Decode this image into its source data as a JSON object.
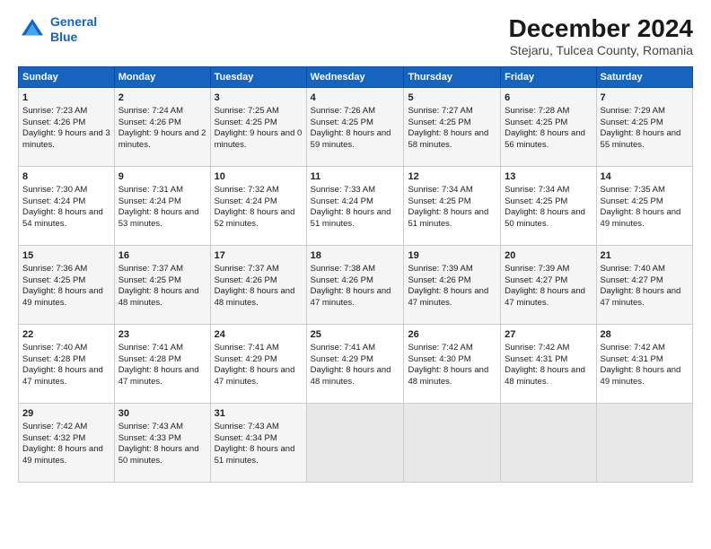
{
  "logo": {
    "line1": "General",
    "line2": "Blue"
  },
  "title": "December 2024",
  "subtitle": "Stejaru, Tulcea County, Romania",
  "header_days": [
    "Sunday",
    "Monday",
    "Tuesday",
    "Wednesday",
    "Thursday",
    "Friday",
    "Saturday"
  ],
  "weeks": [
    [
      {
        "day": "1",
        "sunrise": "7:23 AM",
        "sunset": "4:26 PM",
        "daylight": "9 hours and 3 minutes."
      },
      {
        "day": "2",
        "sunrise": "7:24 AM",
        "sunset": "4:26 PM",
        "daylight": "9 hours and 2 minutes."
      },
      {
        "day": "3",
        "sunrise": "7:25 AM",
        "sunset": "4:25 PM",
        "daylight": "9 hours and 0 minutes."
      },
      {
        "day": "4",
        "sunrise": "7:26 AM",
        "sunset": "4:25 PM",
        "daylight": "8 hours and 59 minutes."
      },
      {
        "day": "5",
        "sunrise": "7:27 AM",
        "sunset": "4:25 PM",
        "daylight": "8 hours and 58 minutes."
      },
      {
        "day": "6",
        "sunrise": "7:28 AM",
        "sunset": "4:25 PM",
        "daylight": "8 hours and 56 minutes."
      },
      {
        "day": "7",
        "sunrise": "7:29 AM",
        "sunset": "4:25 PM",
        "daylight": "8 hours and 55 minutes."
      }
    ],
    [
      {
        "day": "8",
        "sunrise": "7:30 AM",
        "sunset": "4:24 PM",
        "daylight": "8 hours and 54 minutes."
      },
      {
        "day": "9",
        "sunrise": "7:31 AM",
        "sunset": "4:24 PM",
        "daylight": "8 hours and 53 minutes."
      },
      {
        "day": "10",
        "sunrise": "7:32 AM",
        "sunset": "4:24 PM",
        "daylight": "8 hours and 52 minutes."
      },
      {
        "day": "11",
        "sunrise": "7:33 AM",
        "sunset": "4:24 PM",
        "daylight": "8 hours and 51 minutes."
      },
      {
        "day": "12",
        "sunrise": "7:34 AM",
        "sunset": "4:25 PM",
        "daylight": "8 hours and 51 minutes."
      },
      {
        "day": "13",
        "sunrise": "7:34 AM",
        "sunset": "4:25 PM",
        "daylight": "8 hours and 50 minutes."
      },
      {
        "day": "14",
        "sunrise": "7:35 AM",
        "sunset": "4:25 PM",
        "daylight": "8 hours and 49 minutes."
      }
    ],
    [
      {
        "day": "15",
        "sunrise": "7:36 AM",
        "sunset": "4:25 PM",
        "daylight": "8 hours and 49 minutes."
      },
      {
        "day": "16",
        "sunrise": "7:37 AM",
        "sunset": "4:25 PM",
        "daylight": "8 hours and 48 minutes."
      },
      {
        "day": "17",
        "sunrise": "7:37 AM",
        "sunset": "4:26 PM",
        "daylight": "8 hours and 48 minutes."
      },
      {
        "day": "18",
        "sunrise": "7:38 AM",
        "sunset": "4:26 PM",
        "daylight": "8 hours and 47 minutes."
      },
      {
        "day": "19",
        "sunrise": "7:39 AM",
        "sunset": "4:26 PM",
        "daylight": "8 hours and 47 minutes."
      },
      {
        "day": "20",
        "sunrise": "7:39 AM",
        "sunset": "4:27 PM",
        "daylight": "8 hours and 47 minutes."
      },
      {
        "day": "21",
        "sunrise": "7:40 AM",
        "sunset": "4:27 PM",
        "daylight": "8 hours and 47 minutes."
      }
    ],
    [
      {
        "day": "22",
        "sunrise": "7:40 AM",
        "sunset": "4:28 PM",
        "daylight": "8 hours and 47 minutes."
      },
      {
        "day": "23",
        "sunrise": "7:41 AM",
        "sunset": "4:28 PM",
        "daylight": "8 hours and 47 minutes."
      },
      {
        "day": "24",
        "sunrise": "7:41 AM",
        "sunset": "4:29 PM",
        "daylight": "8 hours and 47 minutes."
      },
      {
        "day": "25",
        "sunrise": "7:41 AM",
        "sunset": "4:29 PM",
        "daylight": "8 hours and 48 minutes."
      },
      {
        "day": "26",
        "sunrise": "7:42 AM",
        "sunset": "4:30 PM",
        "daylight": "8 hours and 48 minutes."
      },
      {
        "day": "27",
        "sunrise": "7:42 AM",
        "sunset": "4:31 PM",
        "daylight": "8 hours and 48 minutes."
      },
      {
        "day": "28",
        "sunrise": "7:42 AM",
        "sunset": "4:31 PM",
        "daylight": "8 hours and 49 minutes."
      }
    ],
    [
      {
        "day": "29",
        "sunrise": "7:42 AM",
        "sunset": "4:32 PM",
        "daylight": "8 hours and 49 minutes."
      },
      {
        "day": "30",
        "sunrise": "7:43 AM",
        "sunset": "4:33 PM",
        "daylight": "8 hours and 50 minutes."
      },
      {
        "day": "31",
        "sunrise": "7:43 AM",
        "sunset": "4:34 PM",
        "daylight": "8 hours and 51 minutes."
      },
      null,
      null,
      null,
      null
    ]
  ]
}
